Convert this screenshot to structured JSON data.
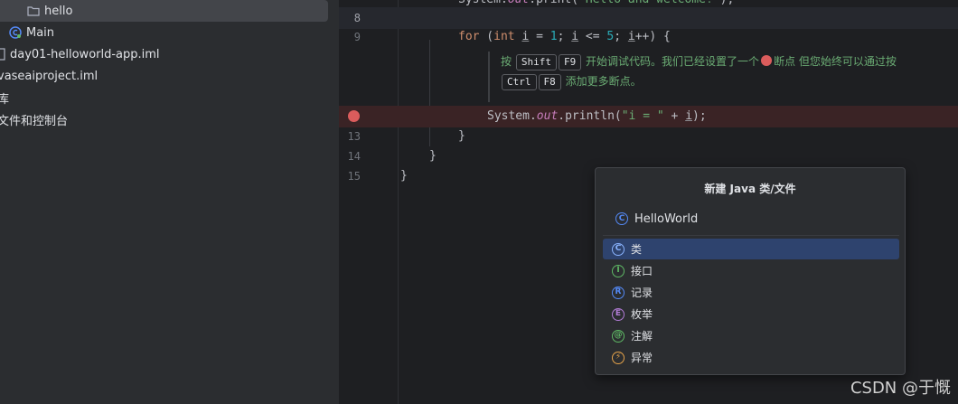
{
  "tree": {
    "items": [
      {
        "label": "hello",
        "icon": "folder-icon",
        "selected": true
      },
      {
        "label": "Main",
        "icon": "java-class-icon"
      },
      {
        "label": "day01-helloworld-app.iml",
        "icon": "iml-file-icon"
      },
      {
        "label": "vaseaiproject.iml",
        "icon": "iml-file-icon"
      },
      {
        "label": "库",
        "icon": ""
      },
      {
        "label": "文件和控制台",
        "icon": ""
      }
    ]
  },
  "editor": {
    "line_numbers": [
      "8",
      "9",
      "13",
      "14",
      "15"
    ],
    "line9": {
      "kw_for": "for",
      "paren": " (",
      "kw_int": "int",
      "var1": "i",
      "eq": " = ",
      "n1": "1",
      "semi1": "; ",
      "var2": "i",
      "le": " <= ",
      "n5": "5",
      "semi2": "; ",
      "var3": "i",
      "inc": "++) {"
    },
    "hint": {
      "press": "按",
      "key1": "Shift",
      "key2": "F9",
      "text1": "开始调试代码。我们已经设置了一个",
      "text2": "断点 但您始终可以通过按",
      "key3": "Ctrl",
      "key4": "F8",
      "text3": "添加更多断点。"
    },
    "line12": {
      "sys": "System.",
      "out": "out",
      "println": ".println(",
      "str": "\"i = \"",
      "plus": " + ",
      "var": "i",
      "end": ");"
    },
    "line13": "}",
    "line14": "}",
    "line15": "}",
    "breakpoint_color": "#db5c5c"
  },
  "popup": {
    "title": "新建 Java 类/文件",
    "input_value": "HelloWorld",
    "options": [
      {
        "label": "类",
        "icon": "class-icon",
        "letter": "C",
        "color": "#548af7",
        "selected": true
      },
      {
        "label": "接口",
        "icon": "interface-icon",
        "letter": "I",
        "color": "#5fb865"
      },
      {
        "label": "记录",
        "icon": "record-icon",
        "letter": "R",
        "color": "#548af7"
      },
      {
        "label": "枚举",
        "icon": "enum-icon",
        "letter": "E",
        "color": "#b27cd6"
      },
      {
        "label": "注解",
        "icon": "annotation-icon",
        "letter": "@",
        "color": "#5fb865"
      },
      {
        "label": "异常",
        "icon": "exception-icon",
        "letter": "⚡",
        "color": "#e5a34a"
      }
    ],
    "selected_bg": "#2e436e"
  },
  "watermark": "CSDN @于慨"
}
